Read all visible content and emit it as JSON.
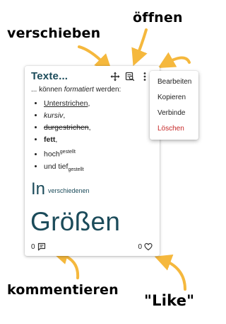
{
  "callouts": {
    "move": "verschieben",
    "open": "öffnen",
    "comment": "kommentieren",
    "like": "\"Like\""
  },
  "card": {
    "title": "Texte...",
    "intro_pre": "... können ",
    "intro_em": "formatiert",
    "intro_post": " werden:",
    "list": {
      "underline": "Unterstrichen",
      "underline_suffix": ",",
      "italic": "kursiv",
      "italic_suffix": ",",
      "strike": "durgestrichen",
      "strike_suffix": ",",
      "bold": "fett",
      "bold_suffix": ",",
      "sup_base": "hoch",
      "sup_text": "gestellt",
      "sub_base": "und tief",
      "sub_text": "gestellt"
    },
    "big_in": "In",
    "big_in_small": "verschiedenen",
    "big_sizes": "Größen",
    "comments_count": "0",
    "likes_count": "0",
    "icons": [
      "move-icon",
      "open-icon",
      "more-icon",
      "comment-icon",
      "heart-icon"
    ]
  },
  "menu": {
    "items": [
      "Bearbeiten",
      "Kopieren",
      "Verbinde",
      "Löschen"
    ]
  },
  "colors": {
    "title": "#1b4b5a",
    "arrow": "#f5b83d",
    "danger": "#c62828"
  }
}
